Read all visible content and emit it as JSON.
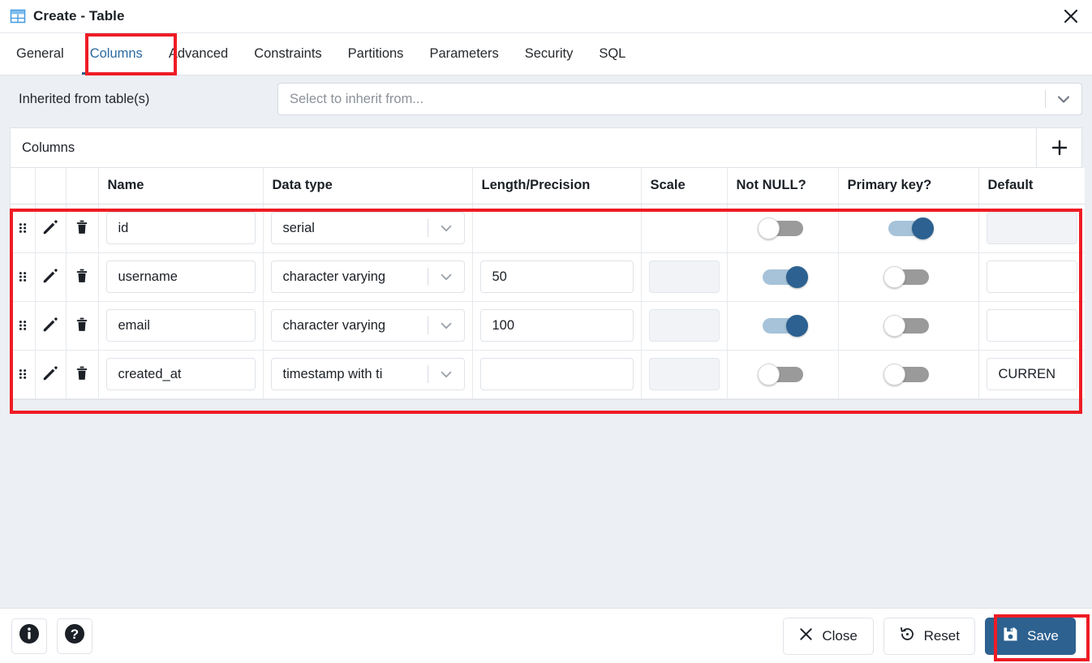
{
  "window": {
    "title": "Create - Table",
    "title_icon": "table-icon",
    "close_icon": "close-icon"
  },
  "tabs": [
    {
      "label": "General",
      "active": false
    },
    {
      "label": "Columns",
      "active": true
    },
    {
      "label": "Advanced",
      "active": false
    },
    {
      "label": "Constraints",
      "active": false
    },
    {
      "label": "Partitions",
      "active": false
    },
    {
      "label": "Parameters",
      "active": false
    },
    {
      "label": "Security",
      "active": false
    },
    {
      "label": "SQL",
      "active": false
    }
  ],
  "inherit": {
    "label": "Inherited from table(s)",
    "placeholder": "Select to inherit from...",
    "value": "",
    "chevron_icon": "chevron-down-icon"
  },
  "grid": {
    "title": "Columns",
    "add_icon": "plus-icon",
    "headers": [
      "",
      "",
      "",
      "Name",
      "Data type",
      "Length/Precision",
      "Scale",
      "Not NULL?",
      "Primary key?",
      "Default"
    ],
    "row_icons": {
      "drag": "drag-handle-icon",
      "edit": "pencil-icon",
      "delete": "trash-icon"
    },
    "rows": [
      {
        "name": "id",
        "data_type": "serial",
        "length": "",
        "length_present": false,
        "scale": "",
        "scale_present": false,
        "not_null": false,
        "primary_key": true,
        "default": "",
        "default_disabled": true
      },
      {
        "name": "username",
        "data_type": "character varying",
        "length": "50",
        "length_present": true,
        "scale": "",
        "scale_present": true,
        "scale_disabled": true,
        "not_null": true,
        "primary_key": false,
        "default": "",
        "default_disabled": false
      },
      {
        "name": "email",
        "data_type": "character varying",
        "length": "100",
        "length_present": true,
        "scale": "",
        "scale_present": true,
        "scale_disabled": true,
        "not_null": true,
        "primary_key": false,
        "default": "",
        "default_disabled": false
      },
      {
        "name": "created_at",
        "data_type": "timestamp with ti",
        "length": "",
        "length_present": true,
        "scale": "",
        "scale_present": true,
        "scale_disabled": true,
        "not_null": false,
        "primary_key": false,
        "default": "CURREN",
        "default_disabled": false
      }
    ]
  },
  "footer": {
    "info_icon": "info-icon",
    "help_icon": "help-icon",
    "close_label": "Close",
    "close_icon": "x-icon",
    "reset_label": "Reset",
    "reset_icon": "reset-icon",
    "save_label": "Save",
    "save_icon": "save-floppy-icon"
  },
  "colors": {
    "accent": "#2d6190",
    "tab_active": "#2c6aa0",
    "toggle_on": "#2c6191",
    "toggle_on_track": "#a6c3d9",
    "toggle_off_track": "#9a9a9a",
    "highlight": "#ee1c25",
    "panel_bg": "#eceff3"
  }
}
